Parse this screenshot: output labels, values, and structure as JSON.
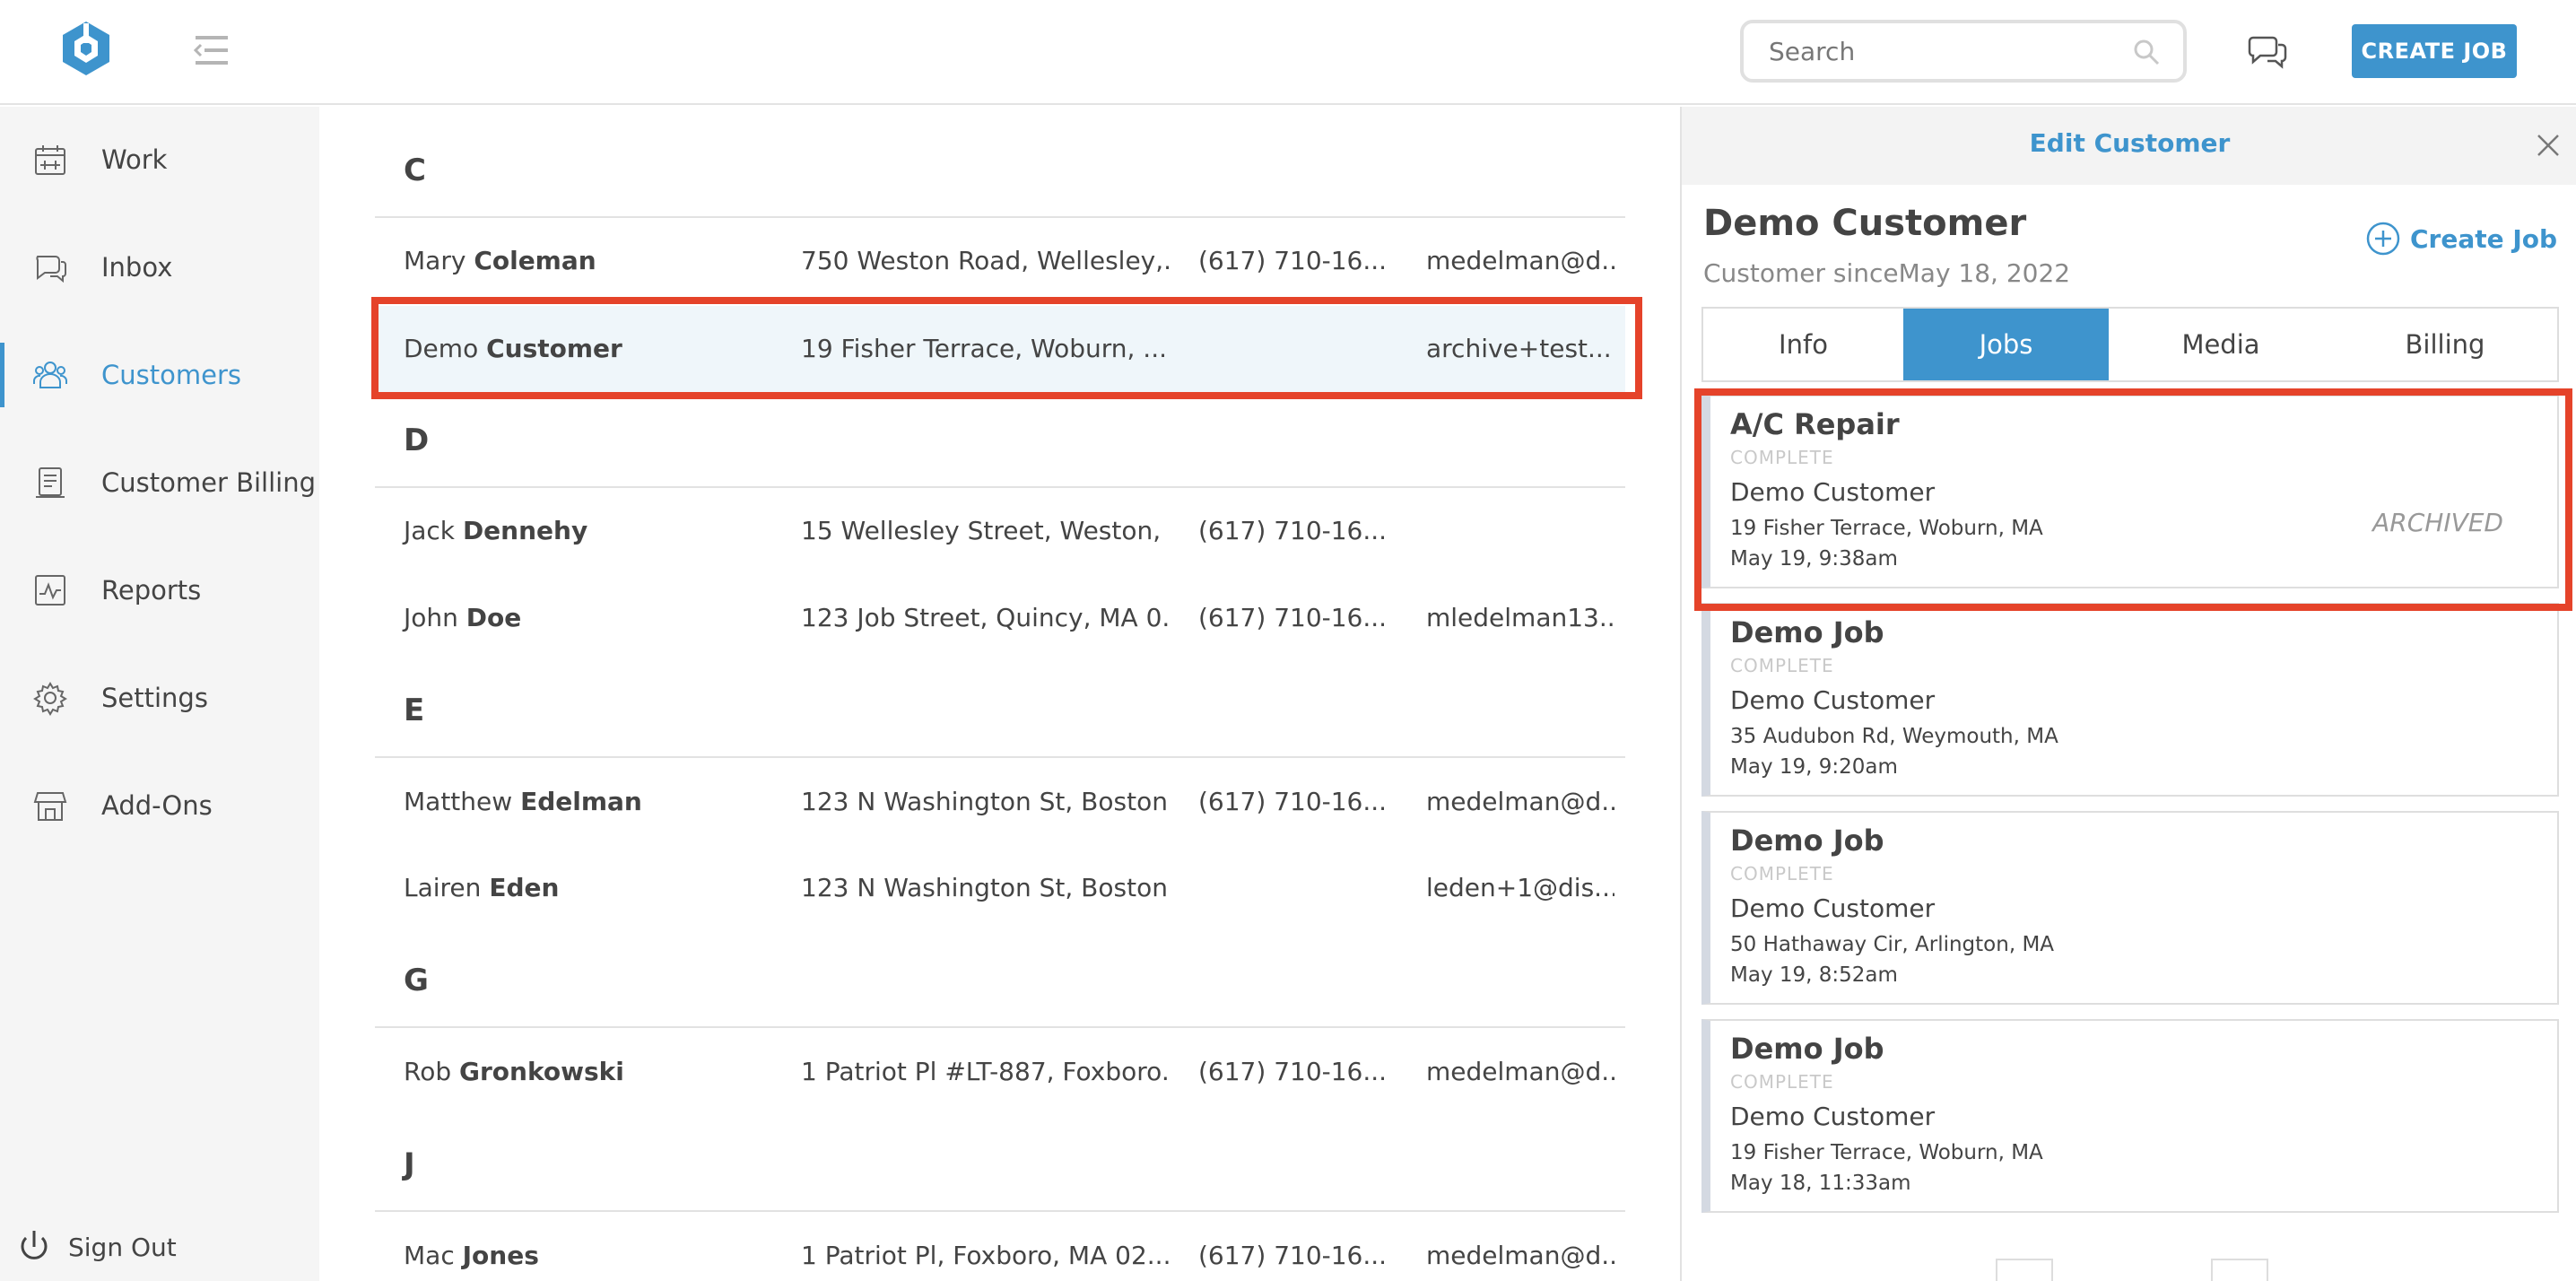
{
  "header": {
    "search_placeholder": "Search",
    "create_job_label": "CREATE JOB",
    "brand_color": "#3e94cd"
  },
  "sidebar": {
    "items": [
      {
        "label": "Work",
        "icon": "calendar-icon"
      },
      {
        "label": "Inbox",
        "icon": "chat-bubbles-icon"
      },
      {
        "label": "Customers",
        "icon": "people-icon",
        "active": true
      },
      {
        "label": "Customer Billing",
        "icon": "receipt-icon"
      },
      {
        "label": "Reports",
        "icon": "chart-icon"
      },
      {
        "label": "Settings",
        "icon": "gear-icon"
      },
      {
        "label": "Add-Ons",
        "icon": "store-icon"
      }
    ],
    "signout_label": "Sign Out"
  },
  "customers": {
    "sections": [
      {
        "letter": "C",
        "rows": [
          {
            "first": "Mary",
            "last": "Coleman",
            "address": "750 Weston Road, Wellesley,...",
            "phone": "(617) 710-16...",
            "email": "medelman@d..."
          },
          {
            "first": "Demo",
            "last": "Customer",
            "address": "19 Fisher Terrace, Woburn, ...",
            "phone": "",
            "email": "archive+test...",
            "selected": true
          }
        ]
      },
      {
        "letter": "D",
        "rows": [
          {
            "first": "Jack",
            "last": "Dennehy",
            "address": "15 Wellesley Street, Weston, ...",
            "phone": "(617) 710-16...",
            "email": ""
          },
          {
            "first": "John",
            "last": "Doe",
            "address": "123 Job Street, Quincy, MA 0...",
            "phone": "(617) 710-16...",
            "email": "mledelman13..."
          }
        ]
      },
      {
        "letter": "E",
        "rows": [
          {
            "first": "Matthew",
            "last": "Edelman",
            "address": "123 N Washington St, Boston...",
            "phone": "(617) 710-16...",
            "email": "medelman@d..."
          },
          {
            "first": "Lairen",
            "last": "Eden",
            "address": "123 N Washington St, Boston...",
            "phone": "",
            "email": "leden+1@dis..."
          }
        ]
      },
      {
        "letter": "G",
        "rows": [
          {
            "first": "Rob",
            "last": "Gronkowski",
            "address": "1 Patriot Pl #LT-887, Foxboro...",
            "phone": "(617) 710-16...",
            "email": "medelman@d..."
          }
        ]
      },
      {
        "letter": "J",
        "rows": [
          {
            "first": "Mac",
            "last": "Jones",
            "address": "1 Patriot Pl, Foxboro, MA 02...",
            "phone": "(617) 710-16...",
            "email": "medelman@d..."
          }
        ]
      }
    ]
  },
  "panel": {
    "title": "Edit Customer",
    "customer_name": "Demo Customer",
    "customer_since": "Customer sinceMay 18, 2022",
    "create_job_label": "Create Job",
    "tabs": [
      {
        "label": "Info"
      },
      {
        "label": "Jobs",
        "active": true
      },
      {
        "label": "Media"
      },
      {
        "label": "Billing"
      }
    ],
    "jobs": [
      {
        "title": "A/C Repair",
        "status": "COMPLETE",
        "customer": "Demo Customer",
        "address": "19 Fisher Terrace, Woburn, MA",
        "time": "May 19, 9:38am",
        "badge": "ARCHIVED"
      },
      {
        "title": "Demo Job",
        "status": "COMPLETE",
        "customer": "Demo Customer",
        "address": "35 Audubon Rd, Weymouth, MA",
        "time": "May 19, 9:20am",
        "badge": ""
      },
      {
        "title": "Demo Job",
        "status": "COMPLETE",
        "customer": "Demo Customer",
        "address": "50 Hathaway Cir, Arlington, MA",
        "time": "May 19, 8:52am",
        "badge": ""
      },
      {
        "title": "Demo Job",
        "status": "COMPLETE",
        "customer": "Demo Customer",
        "address": "19 Fisher Terrace, Woburn, MA",
        "time": "May 18, 11:33am",
        "badge": ""
      }
    ]
  }
}
